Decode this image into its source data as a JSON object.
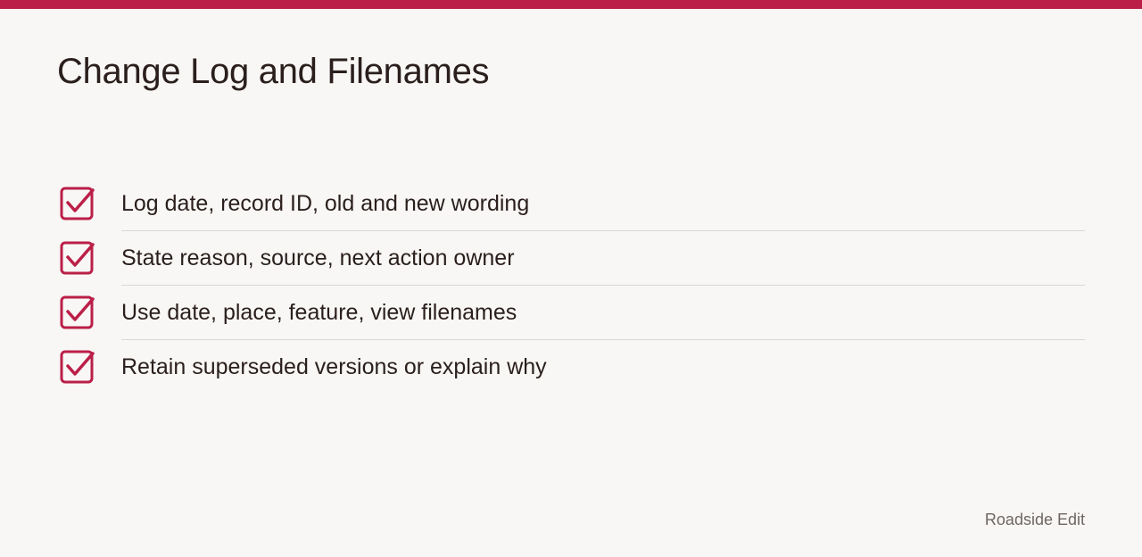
{
  "theme": {
    "accent": "#bb1f48",
    "background": "#f8f7f5",
    "text": "#2a1f1c",
    "muted": "#6f6662"
  },
  "page": {
    "title": "Change Log and Filenames"
  },
  "checklist": {
    "icon": "checkbox-checked-icon",
    "items": [
      {
        "label": "Log date, record ID, old and new wording",
        "checked": true
      },
      {
        "label": "State reason, source, next action owner",
        "checked": true
      },
      {
        "label": "Use date, place, feature, view filenames",
        "checked": true
      },
      {
        "label": "Retain superseded versions or explain why",
        "checked": true
      }
    ]
  },
  "footer": {
    "label": "Roadside Edit"
  }
}
